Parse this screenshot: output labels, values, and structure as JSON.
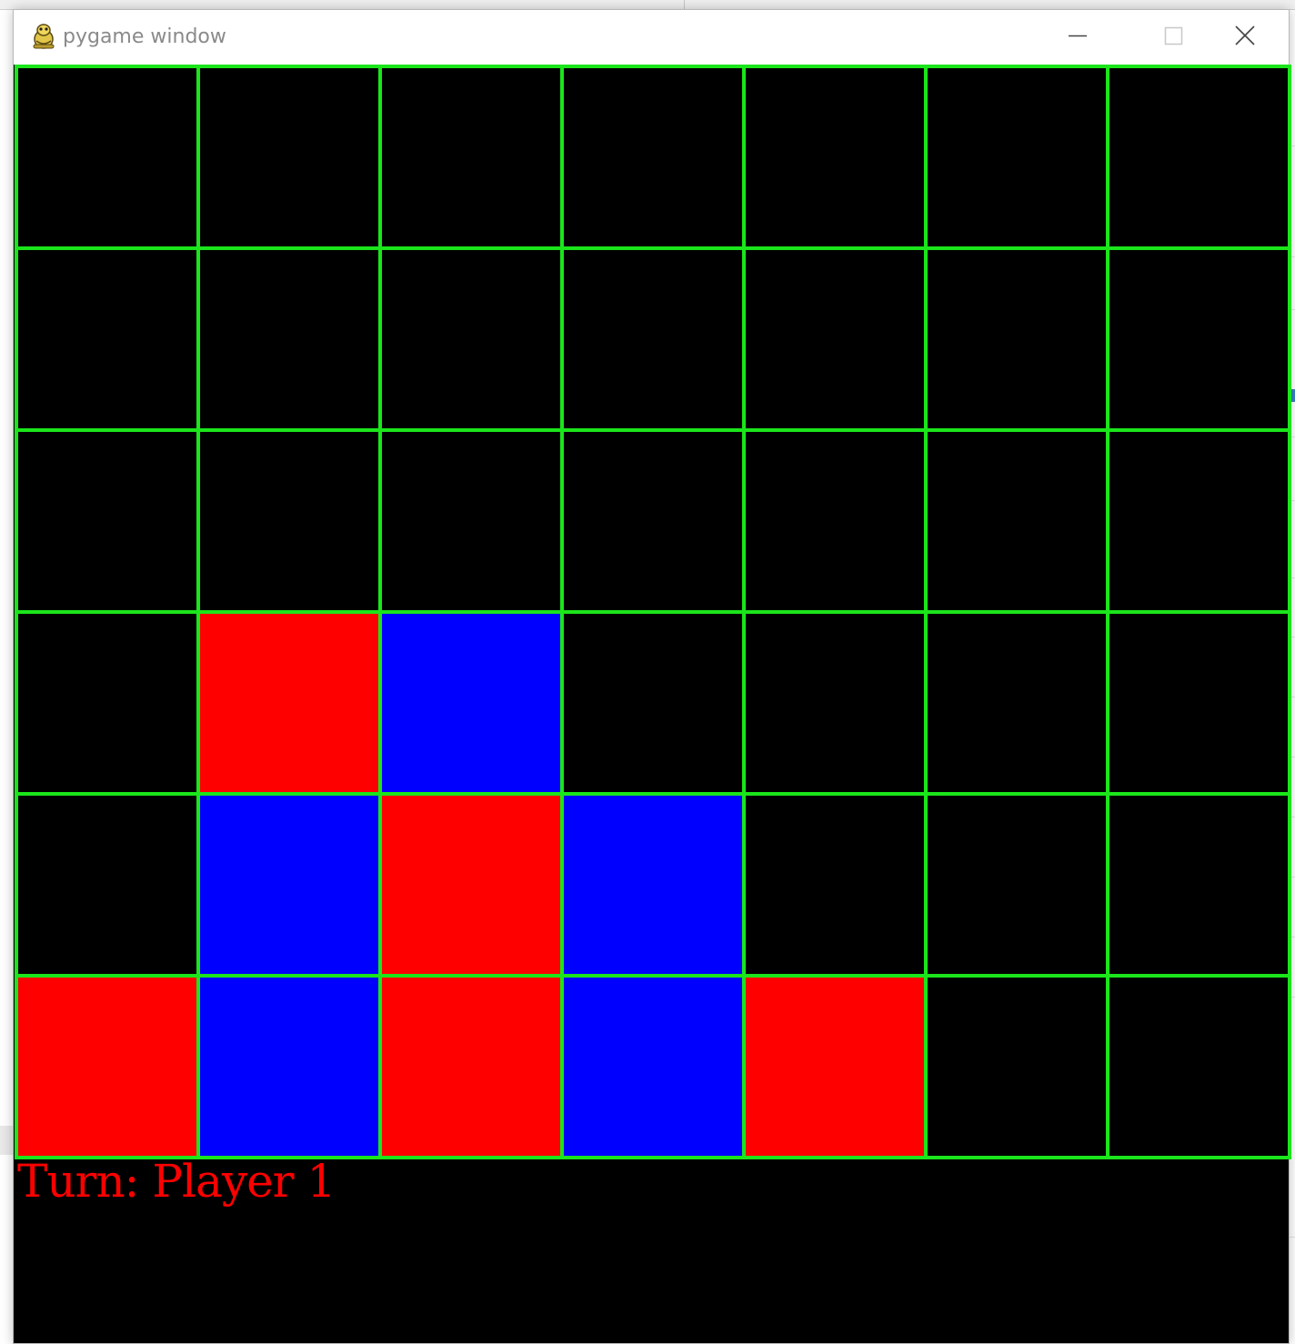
{
  "window": {
    "title": "pygame window",
    "icon": "pygame-snake-icon",
    "controls": {
      "minimize": "minimize-icon",
      "maximize": "maximize-icon",
      "close": "close-icon"
    }
  },
  "game": {
    "rows": 6,
    "cols": 7,
    "colors": {
      "empty": "#000000",
      "player1": "#ff0000",
      "player2": "#0000ff",
      "grid": "#1be51b",
      "status_text": "#ff0000"
    },
    "board": [
      [
        0,
        0,
        0,
        0,
        0,
        0,
        0
      ],
      [
        0,
        0,
        0,
        0,
        0,
        0,
        0
      ],
      [
        0,
        0,
        0,
        0,
        0,
        0,
        0
      ],
      [
        0,
        1,
        2,
        0,
        0,
        0,
        0
      ],
      [
        0,
        2,
        1,
        2,
        0,
        0,
        0
      ],
      [
        1,
        2,
        1,
        2,
        1,
        0,
        0
      ]
    ],
    "status": "Turn: Player 1"
  }
}
